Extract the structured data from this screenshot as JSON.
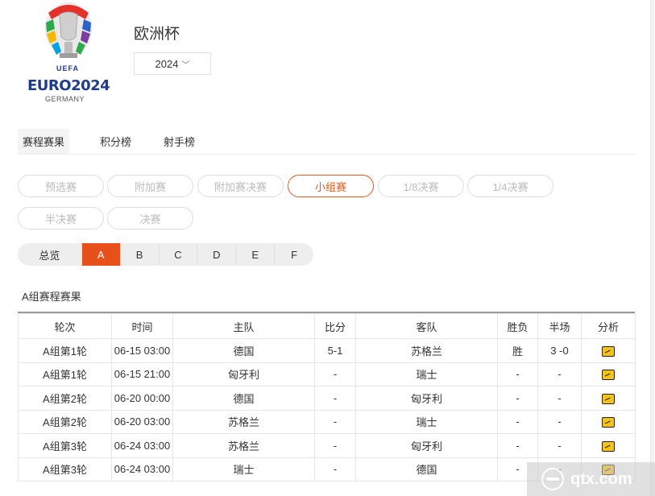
{
  "logo": {
    "uefa": "UEFA",
    "euro": "EURO2024",
    "country": "GERMANY",
    "colors": [
      "#e4322b",
      "#f6b800",
      "#2eaa4a",
      "#2a62c9",
      "#7a3fa0",
      "#00a3e0"
    ]
  },
  "header": {
    "title": "欧洲杯",
    "season": "2024"
  },
  "tabs": [
    {
      "label": "赛程赛果",
      "active": true
    },
    {
      "label": "积分榜",
      "active": false
    },
    {
      "label": "射手榜",
      "active": false
    }
  ],
  "stages": [
    {
      "label": "预选赛"
    },
    {
      "label": "附加赛"
    },
    {
      "label": "附加赛决赛"
    },
    {
      "label": "小组赛",
      "active": true
    },
    {
      "label": "1/8决赛"
    },
    {
      "label": "1/4决赛"
    },
    {
      "label": "半决赛"
    },
    {
      "label": "决赛"
    }
  ],
  "groups": {
    "overview": "总览",
    "items": [
      "A",
      "B",
      "C",
      "D",
      "E",
      "F"
    ],
    "active": "A"
  },
  "section_title": "A组赛程赛果",
  "table": {
    "headers": [
      "轮次",
      "时间",
      "主队",
      "比分",
      "客队",
      "胜负",
      "半场",
      "分析"
    ],
    "rows": [
      {
        "round": "A组第1轮",
        "time": "06-15 03:00",
        "home": "德国",
        "score": "5-1",
        "away": "苏格兰",
        "result": "胜",
        "half": "3 -0"
      },
      {
        "round": "A组第1轮",
        "time": "06-15 21:00",
        "home": "匈牙利",
        "score": "-",
        "away": "瑞士",
        "result": "-",
        "half": "-"
      },
      {
        "round": "A组第2轮",
        "time": "06-20 00:00",
        "home": "德国",
        "score": "-",
        "away": "匈牙利",
        "result": "-",
        "half": "-"
      },
      {
        "round": "A组第2轮",
        "time": "06-20 03:00",
        "home": "苏格兰",
        "score": "-",
        "away": "瑞士",
        "result": "-",
        "half": "-"
      },
      {
        "round": "A组第3轮",
        "time": "06-24 03:00",
        "home": "苏格兰",
        "score": "-",
        "away": "匈牙利",
        "result": "-",
        "half": "-"
      },
      {
        "round": "A组第3轮",
        "time": "06-24 03:00",
        "home": "瑞士",
        "score": "-",
        "away": "德国",
        "result": "-",
        "half": "-"
      }
    ]
  },
  "watermark": "qtx.com",
  "accent": "#e8501a"
}
